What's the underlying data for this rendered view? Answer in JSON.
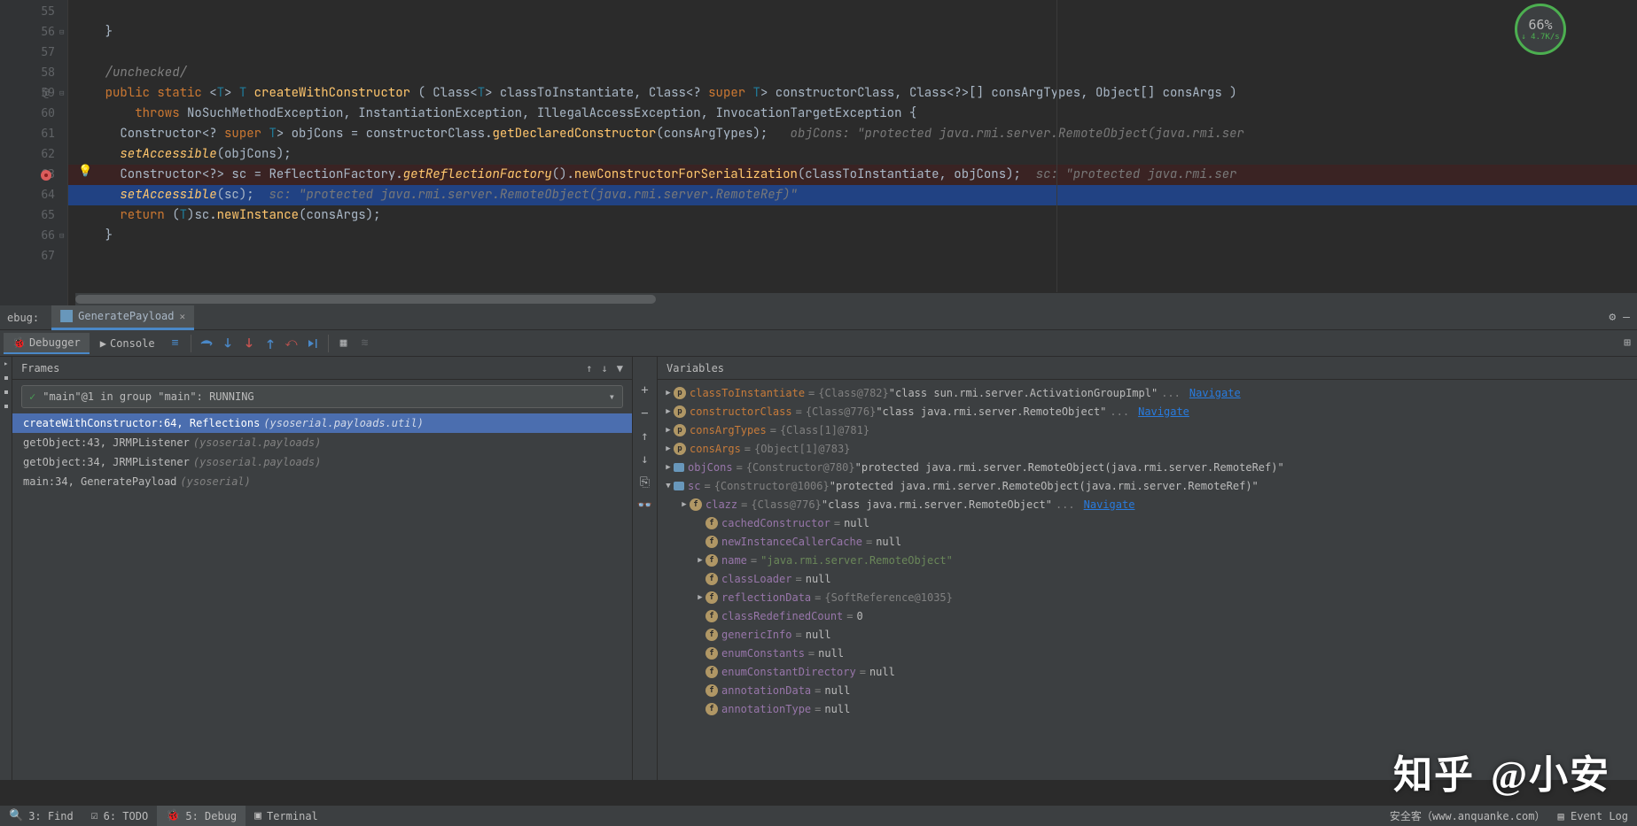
{
  "coverage": {
    "percent": "66%",
    "rate": "↓ 4.7K/s"
  },
  "lines": [
    {
      "n": "55",
      "fold": "",
      "cls": "",
      "html": ""
    },
    {
      "n": "56",
      "fold": "⊟",
      "cls": "",
      "html": "    <span class='pun'>}</span>"
    },
    {
      "n": "57",
      "fold": "",
      "cls": "",
      "html": ""
    },
    {
      "n": "58",
      "fold": "",
      "cls": "",
      "html": "    <span class='cmt'>/unchecked/</span>"
    },
    {
      "n": "59",
      "fold": "⊟",
      "mark": "@",
      "cls": "",
      "html": "    <span class='kw'>public static</span> <span class='pun'>&lt;</span><span class='typ'>T</span><span class='pun'>&gt;</span> <span class='typ'>T</span> <span class='mth'>createWithConstructor</span> <span class='pun'>(</span> <span class='id'>Class</span><span class='pun'>&lt;</span><span class='typ'>T</span><span class='pun'>&gt;</span> <span class='param'>classToInstantiate</span><span class='pun'>,</span> <span class='id'>Class</span><span class='pun'>&lt;?</span> <span class='kw'>super</span> <span class='typ'>T</span><span class='pun'>&gt;</span> <span class='param'>constructorClass</span><span class='pun'>,</span> <span class='id'>Class</span><span class='pun'>&lt;?&gt;[]</span> <span class='param'>consArgTypes</span><span class='pun'>,</span> <span class='id'>Object[]</span> <span class='param'>consArgs</span> <span class='pun'>)</span>"
    },
    {
      "n": "60",
      "fold": "",
      "cls": "",
      "html": "        <span class='kw'>throws</span> <span class='id'>NoSuchMethodException</span><span class='pun'>,</span> <span class='id'>InstantiationException</span><span class='pun'>,</span> <span class='id'>IllegalAccessException</span><span class='pun'>,</span> <span class='id'>InvocationTargetException</span> <span class='pun'>{</span>"
    },
    {
      "n": "61",
      "fold": "",
      "cls": "",
      "html": "      <span class='id'>Constructor</span><span class='pun'>&lt;?</span> <span class='kw'>super</span> <span class='typ'>T</span><span class='pun'>&gt;</span> <span class='id'>objCons</span> <span class='pun'>=</span> <span class='id'>constructorClass</span><span class='pun'>.</span><span class='mth'>getDeclaredConstructor</span><span class='pun'>(</span><span class='id'>consArgTypes</span><span class='pun'>);</span>   <span class='hint'>objCons: &quot;protected java.rmi.server.RemoteObject(java.rmi.ser</span>"
    },
    {
      "n": "62",
      "fold": "",
      "cls": "",
      "html": "      <span class='mthI'>setAccessible</span><span class='pun'>(</span><span class='id'>objCons</span><span class='pun'>);</span>"
    },
    {
      "n": "63",
      "fold": "",
      "bp": true,
      "bulb": true,
      "cls": "hl-bp",
      "html": "      <span class='id'>Constructor</span><span class='pun'>&lt;?&gt;</span> <span class='id'>sc</span> <span class='pun'>=</span> <span class='id'>ReflectionFactory</span><span class='pun'>.</span><span class='mthI'>getReflectionFactory</span><span class='pun'>().</span><span class='mth'>newConstructorForSerialization</span><span class='pun'>(</span><span class='id'>classToInstantiate</span><span class='pun'>,</span> <span class='id'>objCons</span><span class='pun'>);</span>  <span class='hint'>sc: &quot;protected java.rmi.ser</span>"
    },
    {
      "n": "64",
      "fold": "",
      "cls": "hl-sel",
      "html": "      <span class='mthI'>setAccessible</span><span class='pun'>(</span><span class='id'>sc</span><span class='pun'>);</span>  <span class='hint'>sc: &quot;protected java.rmi.server.RemoteObject(java.rmi.server.RemoteRef)&quot;</span>"
    },
    {
      "n": "65",
      "fold": "",
      "cls": "",
      "html": "      <span class='kw'>return</span> <span class='pun'>(</span><span class='typ'>T</span><span class='pun'>)</span><span class='id'>sc</span><span class='pun'>.</span><span class='mth'>newInstance</span><span class='pun'>(</span><span class='id'>consArgs</span><span class='pun'>);</span>"
    },
    {
      "n": "66",
      "fold": "⊟",
      "cls": "",
      "html": "    <span class='pun'>}</span>"
    },
    {
      "n": "67",
      "fold": "",
      "cls": "",
      "html": ""
    }
  ],
  "debug": {
    "label": "ebug:",
    "tab_name": "GeneratePayload",
    "subtabs": {
      "debugger": "Debugger",
      "console": "Console"
    },
    "frames_title": "Frames",
    "vars_title": "Variables",
    "thread": "\"main\"@1 in group \"main\": RUNNING",
    "frames": [
      {
        "text": "createWithConstructor:64, Reflections",
        "src": "(ysoserial.payloads.util)",
        "sel": true
      },
      {
        "text": "getObject:43, JRMPListener",
        "src": "(ysoserial.payloads)",
        "sel": false
      },
      {
        "text": "getObject:34, JRMPListener",
        "src": "(ysoserial.payloads)",
        "sel": false
      },
      {
        "text": "main:34, GeneratePayload",
        "src": "(ysoserial)",
        "sel": false
      }
    ],
    "vars": [
      {
        "d": 0,
        "arr": "▶",
        "icon": "p",
        "name": "classToInstantiate",
        "eq": "=",
        "type": "{Class@782}",
        "val": "\"class sun.rmi.server.ActivationGroupImpl\"",
        "nav": "Navigate",
        "nc": "c"
      },
      {
        "d": 0,
        "arr": "▶",
        "icon": "p",
        "name": "constructorClass",
        "eq": "=",
        "type": "{Class@776}",
        "val": "\"class java.rmi.server.RemoteObject\"",
        "nav": "Navigate",
        "nc": "c"
      },
      {
        "d": 0,
        "arr": "▶",
        "icon": "p",
        "name": "consArgTypes",
        "eq": "=",
        "type": "{Class[1]@781}",
        "val": "",
        "nc": "c"
      },
      {
        "d": 0,
        "arr": "▶",
        "icon": "p",
        "name": "consArgs",
        "eq": "=",
        "type": "{Object[1]@783}",
        "val": "",
        "nc": "c"
      },
      {
        "d": 0,
        "arr": "▶",
        "icon": "o",
        "name": "objCons",
        "eq": "=",
        "type": "{Constructor@780}",
        "val": "\"protected java.rmi.server.RemoteObject(java.rmi.server.RemoteRef)\"",
        "nc": ""
      },
      {
        "d": 0,
        "arr": "▼",
        "icon": "o",
        "name": "sc",
        "eq": "=",
        "type": "{Constructor@1006}",
        "val": "\"protected java.rmi.server.RemoteObject(java.rmi.server.RemoteRef)\"",
        "nc": ""
      },
      {
        "d": 1,
        "arr": "▶",
        "icon": "f",
        "name": "clazz",
        "eq": "=",
        "type": "{Class@776}",
        "val": "\"class java.rmi.server.RemoteObject\"",
        "nav": "Navigate",
        "nc": ""
      },
      {
        "d": 2,
        "arr": "",
        "icon": "f",
        "name": "cachedConstructor",
        "eq": "=",
        "type": "",
        "val": "null",
        "nc": ""
      },
      {
        "d": 2,
        "arr": "",
        "icon": "f",
        "name": "newInstanceCallerCache",
        "eq": "=",
        "type": "",
        "val": "null",
        "nc": ""
      },
      {
        "d": 2,
        "arr": "▶",
        "icon": "f",
        "name": "name",
        "eq": "=",
        "type": "",
        "val": "\"java.rmi.server.RemoteObject\"",
        "str": true,
        "nc": ""
      },
      {
        "d": 2,
        "arr": "",
        "icon": "f",
        "name": "classLoader",
        "eq": "=",
        "type": "",
        "val": "null",
        "nc": ""
      },
      {
        "d": 2,
        "arr": "▶",
        "icon": "f",
        "name": "reflectionData",
        "eq": "=",
        "type": "{SoftReference@1035}",
        "val": "",
        "nc": ""
      },
      {
        "d": 2,
        "arr": "",
        "icon": "f",
        "name": "classRedefinedCount",
        "eq": "=",
        "type": "",
        "val": "0",
        "nc": ""
      },
      {
        "d": 2,
        "arr": "",
        "icon": "f",
        "name": "genericInfo",
        "eq": "=",
        "type": "",
        "val": "null",
        "nc": ""
      },
      {
        "d": 2,
        "arr": "",
        "icon": "f",
        "name": "enumConstants",
        "eq": "=",
        "type": "",
        "val": "null",
        "nc": ""
      },
      {
        "d": 2,
        "arr": "",
        "icon": "f",
        "name": "enumConstantDirectory",
        "eq": "=",
        "type": "",
        "val": "null",
        "nc": ""
      },
      {
        "d": 2,
        "arr": "",
        "icon": "f",
        "name": "annotationData",
        "eq": "=",
        "type": "",
        "val": "null",
        "nc": ""
      },
      {
        "d": 2,
        "arr": "",
        "icon": "f",
        "name": "annotationType",
        "eq": "=",
        "type": "",
        "val": "null",
        "nc": ""
      }
    ]
  },
  "status": {
    "find": "3: Find",
    "todo": "6: TODO",
    "debug": "5: Debug",
    "terminal": "Terminal",
    "source": "安全客（www.anquanke.com）",
    "event_log": "Event Log"
  },
  "watermark": {
    "brand": "知乎",
    "at": "@小安"
  }
}
